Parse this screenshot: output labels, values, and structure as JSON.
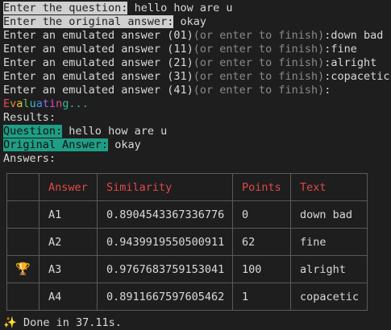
{
  "prompts": {
    "question_label": "Enter the question:",
    "question_value": "hello how are u",
    "original_label": "Enter the original answer:",
    "original_value": "okay"
  },
  "emulated": [
    {
      "label": "Enter an emulated answer (01)",
      "hint": "(or enter to finish)",
      "colon": ":",
      "value": "down bad"
    },
    {
      "label": "Enter an emulated answer (11)",
      "hint": "(or enter to finish)",
      "colon": ":",
      "value": "fine"
    },
    {
      "label": "Enter an emulated answer (21)",
      "hint": "(or enter to finish)",
      "colon": ":",
      "value": "alright"
    },
    {
      "label": "Enter an emulated answer (31)",
      "hint": "(or enter to finish)",
      "colon": ":",
      "value": "copacetic"
    },
    {
      "label": "Enter an emulated answer (41)",
      "hint": "(or enter to finish)",
      "colon": ":",
      "value": ""
    }
  ],
  "evaluating": {
    "text": "Evaluating...",
    "colors": [
      "#e24a4a",
      "#e9833a",
      "#e6c33a",
      "#5fc45f",
      "#3fbfbf",
      "#4a8ce6",
      "#9b6ae6",
      "#d94ad9",
      "#e24a8a",
      "#2fb89a",
      "#2fb89a",
      "#2fb89a",
      "#2fb89a"
    ]
  },
  "results": {
    "heading": "Results:",
    "question_label": "Question:",
    "question_value": "hello how are u",
    "original_label": "Original Answer:",
    "original_value": "okay",
    "answers_heading": "Answers:"
  },
  "table": {
    "headers": [
      "",
      "Answer",
      "Similarity",
      "Points",
      "Text"
    ],
    "rows": [
      {
        "icon": "",
        "answer": "A1",
        "similarity": "0.8904543367336776",
        "points": "0",
        "text": "down bad"
      },
      {
        "icon": "trophy-icon",
        "answer": "A2",
        "similarity": "0.9439919550500911",
        "points": "62",
        "text": "fine"
      },
      {
        "icon": "trophy-icon",
        "answer": "A3",
        "similarity": "0.9767683759153041",
        "points": "100",
        "text": "alright"
      },
      {
        "icon": "",
        "answer": "A4",
        "similarity": "0.8911667597605462",
        "points": "1",
        "text": "copacetic"
      }
    ],
    "trophy_row_index": 2
  },
  "footer": {
    "icon": "sparkles-icon",
    "text": " Done in 37.11s."
  }
}
